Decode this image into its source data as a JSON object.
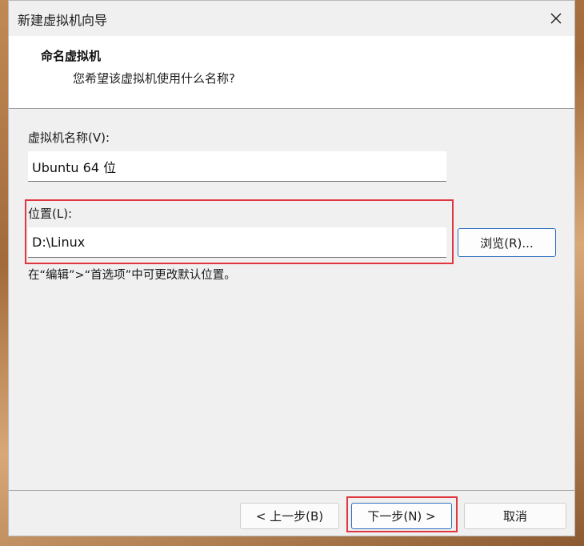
{
  "window": {
    "title": "新建虚拟机向导"
  },
  "header": {
    "title": "命名虚拟机",
    "subtitle": "您希望该虚拟机使用什么名称?"
  },
  "name_field": {
    "label": "虚拟机名称(V):",
    "value": "Ubuntu 64 位"
  },
  "location_field": {
    "label": "位置(L):",
    "value": "D:\\Linux"
  },
  "browse_button": {
    "label": "浏览(R)..."
  },
  "hint": "在“编辑”>“首选项”中可更改默认位置。",
  "buttons": {
    "back": "< 上一步(B)",
    "next": "下一步(N) >",
    "cancel": "取消"
  },
  "colors": {
    "highlight": "#e0373f",
    "accent": "#2f6fc0"
  }
}
